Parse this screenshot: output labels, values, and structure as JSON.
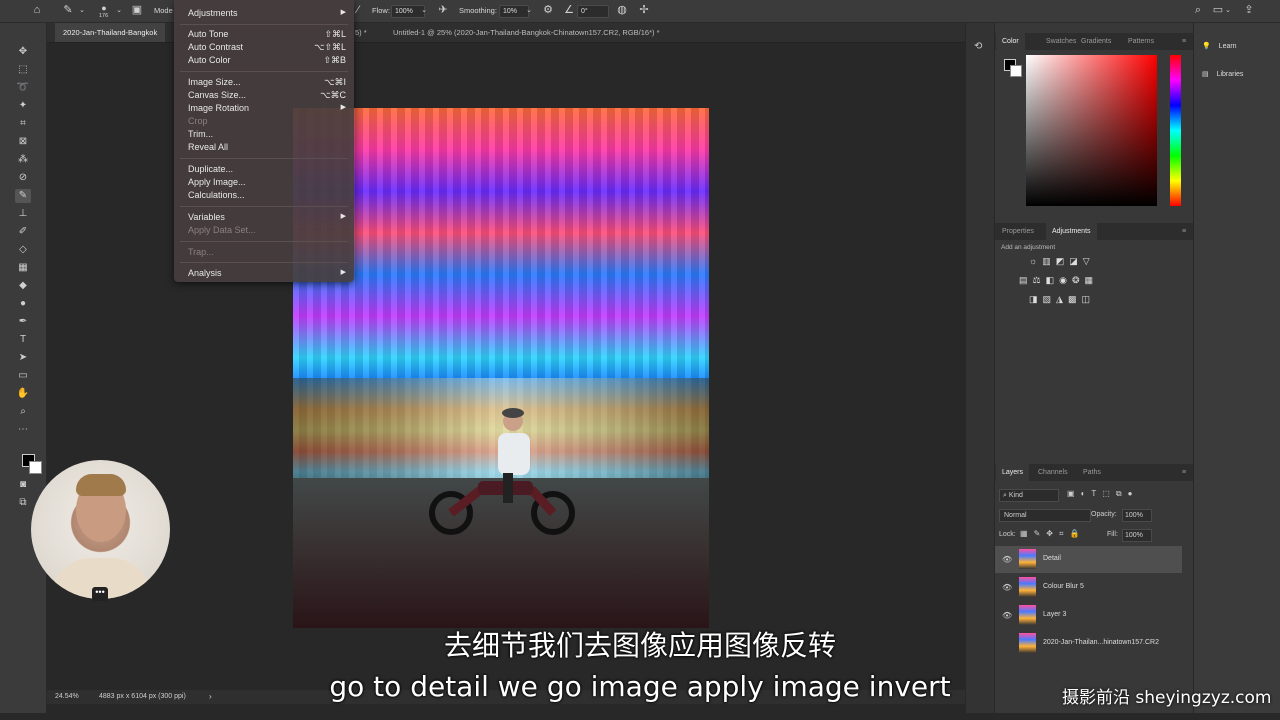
{
  "options_bar": {
    "brush_size": "176",
    "mode_label": "Mode",
    "flow_label": "Flow:",
    "flow_value": "100%",
    "smoothing_label": "Smoothing:",
    "smoothing_value": "10%",
    "angle_value": "0°"
  },
  "tabs": [
    {
      "label": "2020-Jan-Thailand-Bangkok"
    },
    {
      "label": "5) *"
    },
    {
      "label": "Untitled-1 @ 25% (2020-Jan-Thailand-Bangkok-Chinatown157.CR2, RGB/16*) *"
    }
  ],
  "menu": {
    "items": [
      {
        "label": "Adjustments",
        "shortcut": "",
        "submenu": true,
        "disabled": false
      },
      {
        "label": "Auto Tone",
        "shortcut": "⇧⌘L",
        "submenu": false,
        "disabled": false
      },
      {
        "label": "Auto Contrast",
        "shortcut": "⌥⇧⌘L",
        "submenu": false,
        "disabled": false
      },
      {
        "label": "Auto Color",
        "shortcut": "⇧⌘B",
        "submenu": false,
        "disabled": false
      },
      {
        "label": "Image Size...",
        "shortcut": "⌥⌘I",
        "submenu": false,
        "disabled": false
      },
      {
        "label": "Canvas Size...",
        "shortcut": "⌥⌘C",
        "submenu": false,
        "disabled": false
      },
      {
        "label": "Image Rotation",
        "shortcut": "",
        "submenu": true,
        "disabled": false
      },
      {
        "label": "Crop",
        "shortcut": "",
        "submenu": false,
        "disabled": true
      },
      {
        "label": "Trim...",
        "shortcut": "",
        "submenu": false,
        "disabled": false
      },
      {
        "label": "Reveal All",
        "shortcut": "",
        "submenu": false,
        "disabled": false
      },
      {
        "label": "Duplicate...",
        "shortcut": "",
        "submenu": false,
        "disabled": false
      },
      {
        "label": "Apply Image...",
        "shortcut": "",
        "submenu": false,
        "disabled": false
      },
      {
        "label": "Calculations...",
        "shortcut": "",
        "submenu": false,
        "disabled": false
      },
      {
        "label": "Variables",
        "shortcut": "",
        "submenu": true,
        "disabled": false
      },
      {
        "label": "Apply Data Set...",
        "shortcut": "",
        "submenu": false,
        "disabled": true
      },
      {
        "label": "Trap...",
        "shortcut": "",
        "submenu": false,
        "disabled": true
      },
      {
        "label": "Analysis",
        "shortcut": "",
        "submenu": true,
        "disabled": false
      }
    ]
  },
  "status_bar": {
    "zoom": "24.54%",
    "dimensions": "4883 px x 6104 px (300 ppi)"
  },
  "color_panel": {
    "tabs": [
      "Color",
      "Swatches",
      "Gradients",
      "Patterns"
    ],
    "active_tab": "Color"
  },
  "adjustments_panel": {
    "tabs": [
      "Properties",
      "Adjustments"
    ],
    "active_tab": "Adjustments",
    "hint": "Add an adjustment"
  },
  "far_right": {
    "learn": "Learn",
    "libraries": "Libraries"
  },
  "layers_panel": {
    "tabs": [
      "Layers",
      "Channels",
      "Paths"
    ],
    "active_tab": "Layers",
    "filter_kind": "Kind",
    "blend_mode": "Normal",
    "opacity_label": "Opacity:",
    "opacity_value": "100%",
    "lock_label": "Lock:",
    "fill_label": "Fill:",
    "fill_value": "100%",
    "layers": [
      {
        "name": "Detail",
        "visible": true,
        "selected": true
      },
      {
        "name": "Colour Blur 5",
        "visible": true,
        "selected": false
      },
      {
        "name": "Layer 3",
        "visible": true,
        "selected": false
      },
      {
        "name": "2020-Jan-Thailan...hinatown157.CR2",
        "visible": false,
        "selected": false
      }
    ]
  },
  "subtitles": {
    "chinese": "去细节我们去图像应用图像反转",
    "english": "go to detail we go image apply image invert"
  },
  "watermark": "摄影前沿 sheyingzyz.com",
  "camera_overlay_dots": "•••"
}
